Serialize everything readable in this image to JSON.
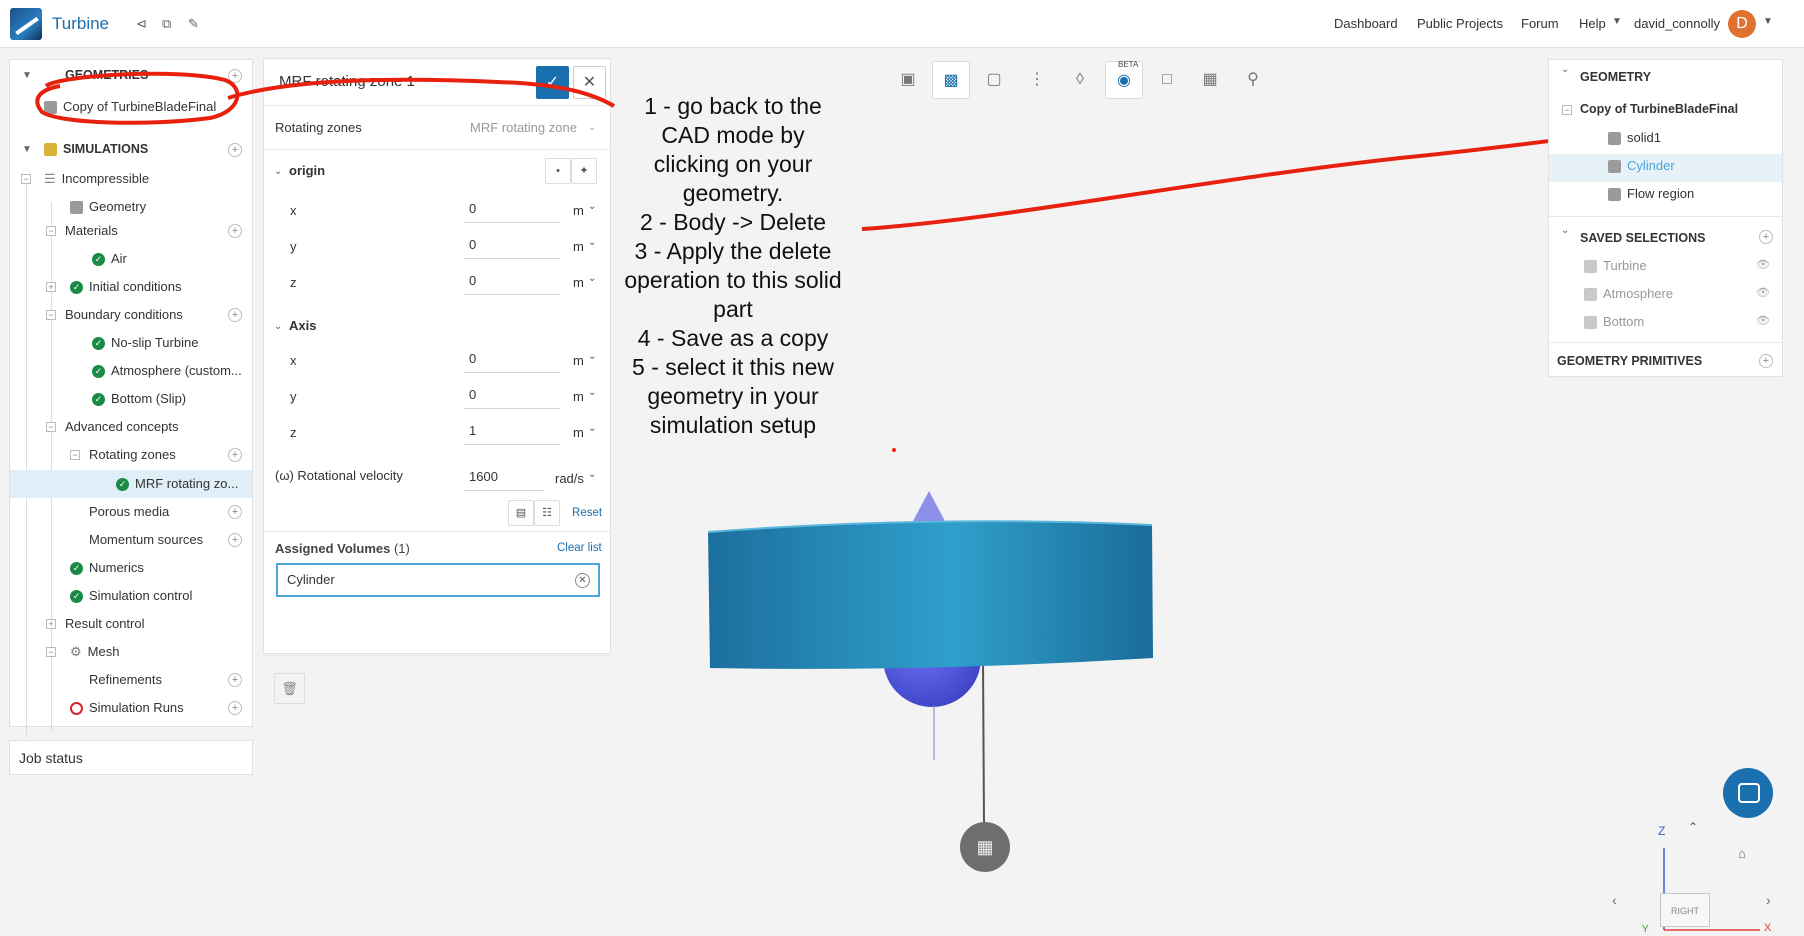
{
  "app": {
    "title": "Turbine",
    "user": "david_connolly",
    "avatar_initial": "D"
  },
  "topnav": [
    "Dashboard",
    "Public Projects",
    "Forum",
    "Help"
  ],
  "tree": {
    "geometries_title": "GEOMETRIES",
    "geometry_item": "Copy of TurbineBladeFinal",
    "simulations_title": "SIMULATIONS",
    "rows": {
      "incompressible": "Incompressible",
      "geometry": "Geometry",
      "materials": "Materials",
      "air": "Air",
      "initial_conditions": "Initial conditions",
      "boundary_conditions": "Boundary conditions",
      "noslip": "No-slip Turbine",
      "atmosphere": "Atmosphere (custom...",
      "bottom": "Bottom (Slip)",
      "advanced": "Advanced concepts",
      "rotating_zones": "Rotating zones",
      "mrf_item": "MRF rotating zo...",
      "porous": "Porous media",
      "momentum": "Momentum sources",
      "numerics": "Numerics",
      "sim_control": "Simulation control",
      "result_control": "Result control",
      "mesh": "Mesh",
      "refinements": "Refinements",
      "sim_runs": "Simulation Runs"
    }
  },
  "job_status": "Job status",
  "dialog": {
    "title": "MRF rotating zone 1",
    "rotating_zones_label": "Rotating zones",
    "rotating_zones_value": "MRF rotating zone",
    "origin_label": "origin",
    "axis_label": "Axis",
    "x": "x",
    "y": "y",
    "z": "z",
    "origin": {
      "x": "0",
      "y": "0",
      "z": "0"
    },
    "axis": {
      "x": "0",
      "y": "0",
      "z": "1"
    },
    "unit_m": "m",
    "rot_vel_label": "(ω) Rotational velocity",
    "rot_vel_value": "1600",
    "rot_vel_unit": "rad/s",
    "reset": "Reset",
    "assigned_label": "Assigned Volumes",
    "assigned_count": "(1)",
    "clear_list": "Clear list",
    "assigned_item": "Cylinder"
  },
  "annotation": "1 - go back to the\nCAD mode by\nclicking on your\ngeometry.\n2 - Body -> Delete\n3 - Apply the delete\noperation to this solid\npart\n4 - Save as a copy\n5 - select it this new\ngeometry in your\nsimulation setup",
  "toolbar": {
    "beta": "BETA"
  },
  "right": {
    "geometry_title": "GEOMETRY",
    "geometry_name": "Copy of TurbineBladeFinal",
    "parts": [
      "solid1",
      "Cylinder",
      "Flow region"
    ],
    "saved_title": "SAVED SELECTIONS",
    "saved": [
      "Turbine",
      "Atmosphere",
      "Bottom"
    ],
    "primitives_title": "GEOMETRY PRIMITIVES"
  },
  "viewcube": {
    "axis_z": "Z",
    "face": "RIGHT",
    "axis_x": "X",
    "axis_y": "Y"
  },
  "colors": {
    "accent": "#1a6fae",
    "annotation_red": "#e8200e",
    "cylinder": "#2b8fbe",
    "ok": "#1a8a46"
  }
}
